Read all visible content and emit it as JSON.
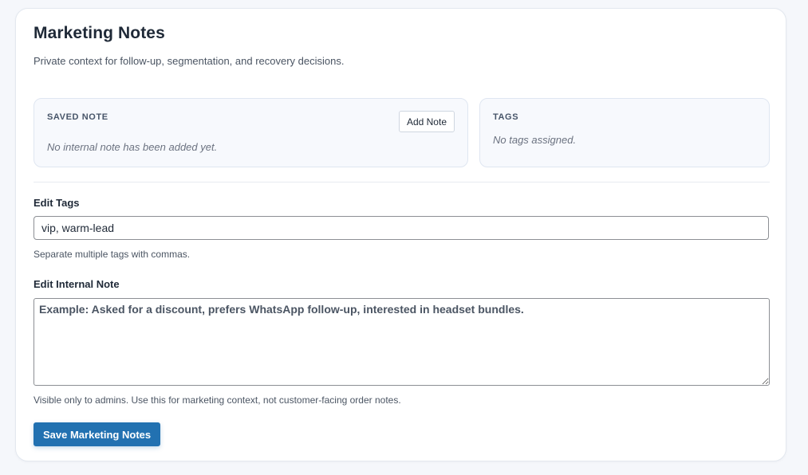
{
  "header": {
    "title": "Marketing Notes",
    "subtitle": "Private context for follow-up, segmentation, and recovery decisions."
  },
  "saved_note": {
    "label": "SAVED NOTE",
    "empty_text": "No internal note has been added yet.",
    "add_button": "Add Note"
  },
  "tags_panel": {
    "label": "TAGS",
    "empty_text": "No tags assigned."
  },
  "edit_tags": {
    "label": "Edit Tags",
    "value": "vip, warm-lead",
    "help": "Separate multiple tags with commas."
  },
  "edit_note": {
    "label": "Edit Internal Note",
    "value": "",
    "placeholder": "Example: Asked for a discount, prefers WhatsApp follow-up, interested in headset bundles.",
    "help": "Visible only to admins. Use this for marketing context, not customer-facing order notes."
  },
  "actions": {
    "save_label": "Save Marketing Notes"
  },
  "colors": {
    "primary": "#2271b1",
    "panel_bg": "#f7f9fd",
    "page_bg": "#f5f7fb"
  }
}
